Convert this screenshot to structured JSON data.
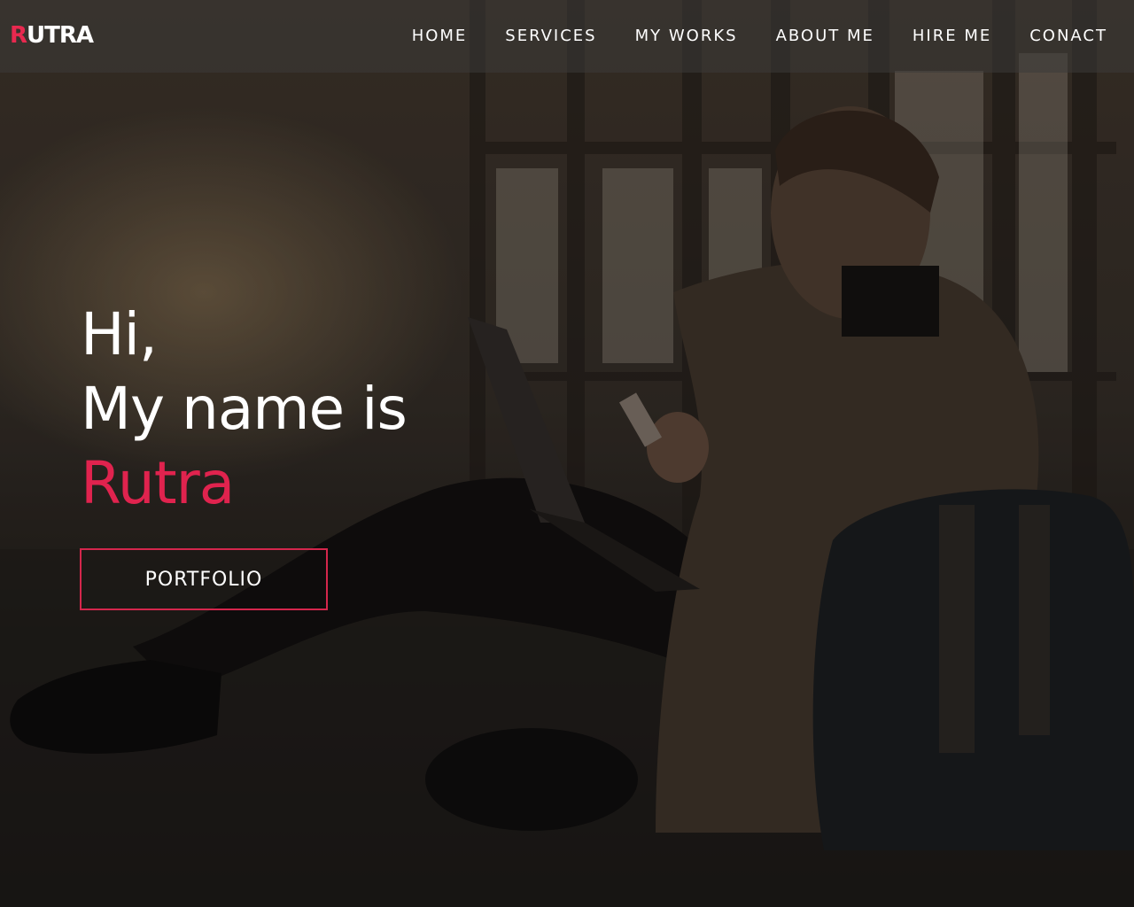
{
  "brand": {
    "first_letter": "R",
    "rest": "UTRA",
    "accent_color": "#e0234e"
  },
  "nav": {
    "items": [
      {
        "label": "HOME"
      },
      {
        "label": "SERVICES"
      },
      {
        "label": "MY WORKS"
      },
      {
        "label": "ABOUT ME"
      },
      {
        "label": "HIRE ME"
      },
      {
        "label": "CONACT"
      }
    ]
  },
  "hero": {
    "line1": "Hi,",
    "line2": "My name is",
    "name": "Rutra",
    "button_label": "PORTFOLIO",
    "background_image": "man-with-laptop-and-backpack-photo"
  }
}
